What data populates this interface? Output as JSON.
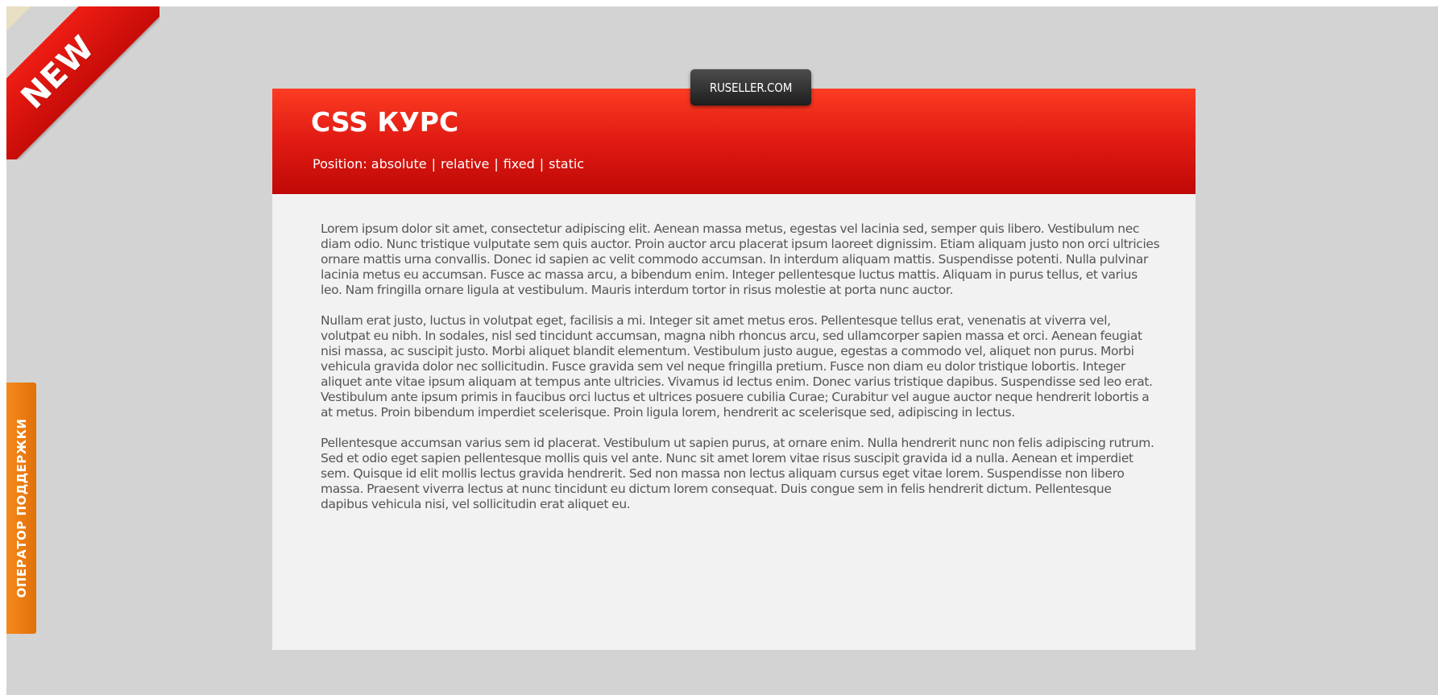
{
  "corner_ribbon": {
    "label": "NEW"
  },
  "support_tab": {
    "label": "ОПЕРАТОР ПОДДЕРЖКИ"
  },
  "badge": {
    "label": "RUSELLER.COM"
  },
  "header": {
    "title": "CSS КУРС",
    "nav_prefix": "Position:",
    "nav_items": [
      "absolute",
      "relative",
      "fixed",
      "static"
    ],
    "separator": "|"
  },
  "content": {
    "paragraphs": [
      "Lorem ipsum dolor sit amet, consectetur adipiscing elit. Aenean massa metus, egestas vel lacinia sed, semper quis libero. Vestibulum nec diam odio. Nunc tristique vulputate sem quis auctor. Proin auctor arcu placerat ipsum laoreet dignissim. Etiam aliquam justo non orci ultricies ornare mattis urna convallis. Donec id sapien ac velit commodo accumsan. In interdum aliquam mattis. Suspendisse potenti. Nulla pulvinar lacinia metus eu accumsan. Fusce ac massa arcu, a bibendum enim. Integer pellentesque luctus mattis. Aliquam in purus tellus, et varius leo. Nam fringilla ornare ligula at vestibulum. Mauris interdum tortor in risus molestie at porta nunc auctor.",
      "Nullam erat justo, luctus in volutpat eget, facilisis a mi. Integer sit amet metus eros. Pellentesque tellus erat, venenatis at viverra vel, volutpat eu nibh. In sodales, nisl sed tincidunt accumsan, magna nibh rhoncus arcu, sed ullamcorper sapien massa et orci. Aenean feugiat nisi massa, ac suscipit justo. Morbi aliquet blandit elementum. Vestibulum justo augue, egestas a commodo vel, aliquet non purus. Morbi vehicula gravida dolor nec sollicitudin. Fusce gravida sem vel neque fringilla pretium. Fusce non diam eu dolor tristique lobortis. Integer aliquet ante vitae ipsum aliquam at tempus ante ultricies. Vivamus id lectus enim. Donec varius tristique dapibus. Suspendisse sed leo erat. Vestibulum ante ipsum primis in faucibus orci luctus et ultrices posuere cubilia Curae; Curabitur vel augue auctor neque hendrerit lobortis a at metus. Proin bibendum imperdiet scelerisque. Proin ligula lorem, hendrerit ac scelerisque sed, adipiscing in lectus.",
      "Pellentesque accumsan varius sem id placerat. Vestibulum ut sapien purus, at ornare enim. Nulla hendrerit nunc non felis adipiscing rutrum. Sed et odio eget sapien pellentesque mollis quis vel ante. Nunc sit amet lorem vitae risus suscipit gravida id a nulla. Aenean et imperdiet sem. Quisque id elit mollis lectus gravida hendrerit. Sed non massa non lectus aliquam cursus eget vitae lorem. Suspendisse non libero massa. Praesent viverra lectus at nunc tincidunt eu dictum lorem consequat. Duis congue sem in felis hendrerit dictum. Pellentesque dapibus vehicula nisi, vel sollicitudin erat aliquet eu."
    ]
  },
  "colors": {
    "page_background": "#d3d3d3",
    "header_red": "#e31d14",
    "ribbon_red": "#ee1d14",
    "support_orange": "#f48a1a",
    "badge_dark": "#2b2b2b",
    "body_text": "#555555"
  }
}
